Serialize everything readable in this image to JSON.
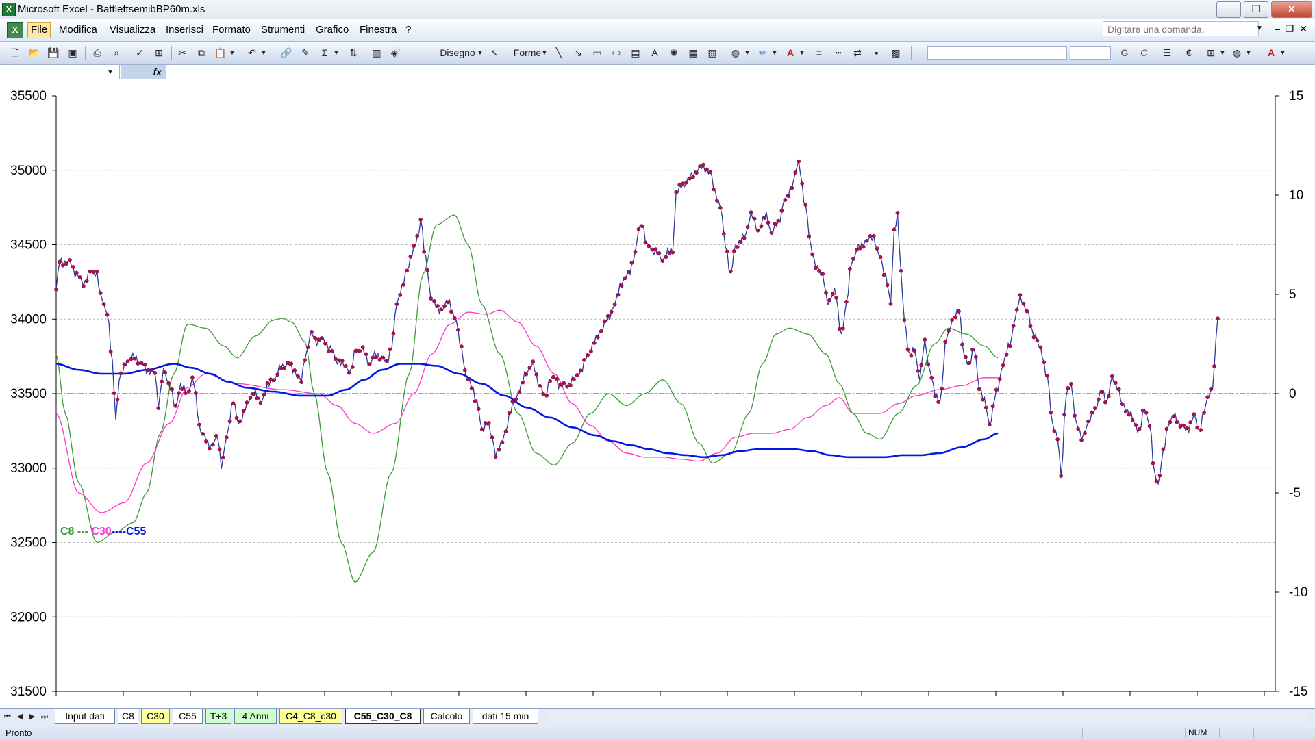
{
  "window": {
    "title": "Microsoft Excel - BattleftsemibBP60m.xls",
    "minimize": "—",
    "maximize": "❐",
    "close": "✕"
  },
  "menu": {
    "items": [
      "File",
      "Modifica",
      "Visualizza",
      "Inserisci",
      "Formato",
      "Strumenti",
      "Grafico",
      "Finestra",
      "?"
    ],
    "help_placeholder": "Digitare una domanda.",
    "mdi": {
      "minimize": "–",
      "restore": "❐",
      "close": "✕"
    }
  },
  "toolbar": {
    "disegno_label": "Disegno",
    "forme_label": "Forme",
    "bold": "G",
    "italic": "C",
    "euro": "€"
  },
  "formula": {
    "fx": "fx",
    "namebox_value": ""
  },
  "chart": {
    "legend": {
      "c8": "C8",
      "sep1": " --- ",
      "c30": "C30",
      "sep2": "----",
      "c55": "C55"
    },
    "colors": {
      "price": "#2b3a9c",
      "markers": "#b0104e",
      "c8": "#3b9a38",
      "c30": "#ff33cc",
      "c55": "#0019e0",
      "zero": "#b04090"
    }
  },
  "chart_data": {
    "type": "line",
    "title": "",
    "x_count": 440,
    "left_axis": {
      "min": 31500,
      "max": 35500,
      "ticks": [
        "31500",
        "32000",
        "32500",
        "33000",
        "33500",
        "34000",
        "34500",
        "35000",
        "35500"
      ]
    },
    "right_axis": {
      "min": -15,
      "max": 15,
      "ticks": [
        "-15",
        "-10",
        "-5",
        "0",
        "5",
        "10",
        "15"
      ]
    },
    "grid": true,
    "price_anchors": [
      [
        0,
        34200
      ],
      [
        2,
        34390
      ],
      [
        8,
        34380
      ],
      [
        12,
        34300
      ],
      [
        16,
        34240
      ],
      [
        20,
        34320
      ],
      [
        24,
        34310
      ],
      [
        26,
        34150
      ],
      [
        30,
        34050
      ],
      [
        33,
        33700
      ],
      [
        35,
        33330
      ],
      [
        37,
        33600
      ],
      [
        42,
        33720
      ],
      [
        46,
        33750
      ],
      [
        50,
        33700
      ],
      [
        54,
        33650
      ],
      [
        58,
        33640
      ],
      [
        60,
        33430
      ],
      [
        63,
        33650
      ],
      [
        67,
        33550
      ],
      [
        70,
        33400
      ],
      [
        73,
        33560
      ],
      [
        77,
        33500
      ],
      [
        80,
        33600
      ],
      [
        85,
        33250
      ],
      [
        90,
        33150
      ],
      [
        95,
        33200
      ],
      [
        97,
        33020
      ],
      [
        100,
        33200
      ],
      [
        104,
        33460
      ],
      [
        107,
        33290
      ],
      [
        112,
        33420
      ],
      [
        116,
        33520
      ],
      [
        120,
        33440
      ],
      [
        124,
        33550
      ],
      [
        128,
        33600
      ],
      [
        132,
        33680
      ],
      [
        136,
        33700
      ],
      [
        140,
        33650
      ],
      [
        144,
        33580
      ],
      [
        146,
        33750
      ],
      [
        150,
        33900
      ],
      [
        153,
        33850
      ],
      [
        157,
        33860
      ],
      [
        161,
        33800
      ],
      [
        165,
        33720
      ],
      [
        170,
        33680
      ],
      [
        173,
        33650
      ],
      [
        176,
        33800
      ],
      [
        180,
        33790
      ],
      [
        184,
        33700
      ],
      [
        187,
        33760
      ],
      [
        191,
        33750
      ],
      [
        194,
        33700
      ],
      [
        197,
        33820
      ],
      [
        200,
        34100
      ],
      [
        203,
        34220
      ],
      [
        206,
        34320
      ],
      [
        209,
        34450
      ],
      [
        211,
        34500
      ],
      [
        213,
        34580
      ],
      [
        214,
        34680
      ],
      [
        217,
        34400
      ],
      [
        220,
        34150
      ],
      [
        225,
        34050
      ],
      [
        230,
        34120
      ],
      [
        234,
        34020
      ],
      [
        238,
        33800
      ],
      [
        241,
        33600
      ],
      [
        244,
        33550
      ],
      [
        247,
        33450
      ],
      [
        250,
        33250
      ],
      [
        253,
        33310
      ],
      [
        256,
        33200
      ],
      [
        258,
        33100
      ],
      [
        261,
        33150
      ],
      [
        264,
        33250
      ],
      [
        266,
        33350
      ],
      [
        269,
        33450
      ],
      [
        272,
        33520
      ],
      [
        276,
        33650
      ],
      [
        280,
        33690
      ],
      [
        284,
        33550
      ],
      [
        287,
        33480
      ],
      [
        290,
        33600
      ],
      [
        293,
        33600
      ],
      [
        296,
        33550
      ],
      [
        300,
        33560
      ],
      [
        304,
        33600
      ],
      [
        308,
        33650
      ],
      [
        312,
        33750
      ],
      [
        316,
        33850
      ],
      [
        320,
        33930
      ],
      [
        324,
        34000
      ],
      [
        328,
        34100
      ],
      [
        332,
        34250
      ],
      [
        336,
        34300
      ],
      [
        340,
        34440
      ],
      [
        342,
        34600
      ],
      [
        344,
        34650
      ],
      [
        347,
        34490
      ],
      [
        351,
        34460
      ],
      [
        356,
        34400
      ],
      [
        359,
        34450
      ],
      [
        362,
        34460
      ],
      [
        364,
        34850
      ],
      [
        368,
        34900
      ],
      [
        372,
        34950
      ],
      [
        376,
        35000
      ],
      [
        380,
        35020
      ],
      [
        384,
        34980
      ],
      [
        387,
        34850
      ],
      [
        390,
        34750
      ],
      [
        393,
        34500
      ],
      [
        396,
        34300
      ],
      [
        399,
        34500
      ],
      [
        404,
        34550
      ],
      [
        408,
        34700
      ],
      [
        412,
        34600
      ],
      [
        417,
        34700
      ],
      [
        420,
        34580
      ],
      [
        424,
        34650
      ],
      [
        428,
        34800
      ],
      [
        432,
        34900
      ],
      [
        436,
        35050
      ],
      [
        440,
        34750
      ],
      [
        443,
        34500
      ],
      [
        446,
        34350
      ],
      [
        450,
        34300
      ],
      [
        453,
        34100
      ],
      [
        457,
        34200
      ],
      [
        461,
        33900
      ],
      [
        464,
        34100
      ],
      [
        467,
        34390
      ],
      [
        471,
        34480
      ],
      [
        476,
        34530
      ],
      [
        480,
        34550
      ],
      [
        483,
        34430
      ],
      [
        487,
        34300
      ],
      [
        490,
        34100
      ],
      [
        492,
        34600
      ],
      [
        494,
        34700
      ],
      [
        496,
        34300
      ],
      [
        498,
        34000
      ],
      [
        501,
        33750
      ],
      [
        504,
        33800
      ],
      [
        507,
        33600
      ],
      [
        510,
        33850
      ],
      [
        513,
        33650
      ],
      [
        516,
        33500
      ],
      [
        519,
        33450
      ],
      [
        523,
        33900
      ],
      [
        527,
        34000
      ],
      [
        530,
        34080
      ],
      [
        533,
        33750
      ],
      [
        536,
        33700
      ],
      [
        539,
        33800
      ],
      [
        542,
        33550
      ],
      [
        545,
        33450
      ],
      [
        548,
        33300
      ],
      [
        552,
        33500
      ],
      [
        556,
        33700
      ],
      [
        560,
        33840
      ],
      [
        563,
        34000
      ],
      [
        566,
        34150
      ],
      [
        570,
        34050
      ],
      [
        574,
        33900
      ],
      [
        578,
        33800
      ],
      [
        582,
        33600
      ],
      [
        585,
        33300
      ],
      [
        588,
        33200
      ],
      [
        590,
        32950
      ],
      [
        593,
        33500
      ],
      [
        596,
        33550
      ],
      [
        599,
        33300
      ],
      [
        602,
        33200
      ],
      [
        606,
        33300
      ],
      [
        610,
        33400
      ],
      [
        614,
        33520
      ],
      [
        617,
        33450
      ],
      [
        620,
        33600
      ],
      [
        623,
        33550
      ],
      [
        626,
        33420
      ],
      [
        630,
        33380
      ],
      [
        633,
        33300
      ],
      [
        636,
        33250
      ],
      [
        639,
        33400
      ],
      [
        642,
        33300
      ],
      [
        645,
        32950
      ],
      [
        647,
        32900
      ],
      [
        650,
        33100
      ],
      [
        653,
        33300
      ],
      [
        656,
        33350
      ],
      [
        660,
        33300
      ],
      [
        664,
        33250
      ],
      [
        668,
        33350
      ],
      [
        671,
        33250
      ],
      [
        674,
        33380
      ],
      [
        677,
        33500
      ],
      [
        679,
        33550
      ],
      [
        682,
        33990
      ]
    ],
    "c8_anchors": [
      [
        0,
        2
      ],
      [
        4,
        -1
      ],
      [
        10,
        -4.5
      ],
      [
        18,
        -7.5
      ],
      [
        26,
        -7
      ],
      [
        34,
        -6.5
      ],
      [
        40,
        -5
      ],
      [
        46,
        -2
      ],
      [
        52,
        1
      ],
      [
        58,
        3.5
      ],
      [
        66,
        3.3
      ],
      [
        74,
        2.4
      ],
      [
        80,
        1.8
      ],
      [
        88,
        2.9
      ],
      [
        96,
        3.7
      ],
      [
        100,
        3.8
      ],
      [
        104,
        3.6
      ],
      [
        110,
        2.6
      ],
      [
        114,
        0
      ],
      [
        120,
        -4
      ],
      [
        126,
        -7.5
      ],
      [
        132,
        -9.5
      ],
      [
        140,
        -8
      ],
      [
        148,
        -4
      ],
      [
        156,
        1
      ],
      [
        162,
        6
      ],
      [
        168,
        8.5
      ],
      [
        176,
        9
      ],
      [
        182,
        7.5
      ],
      [
        188,
        4.5
      ],
      [
        196,
        2
      ],
      [
        204,
        -1
      ],
      [
        212,
        -3
      ],
      [
        220,
        -3.6
      ],
      [
        228,
        -2.5
      ],
      [
        236,
        -1
      ],
      [
        244,
        0
      ],
      [
        252,
        -0.6
      ],
      [
        260,
        0
      ],
      [
        268,
        0.7
      ],
      [
        276,
        -0.5
      ],
      [
        284,
        -2.5
      ],
      [
        290,
        -3.5
      ],
      [
        298,
        -3
      ],
      [
        306,
        -1
      ],
      [
        312,
        1.5
      ],
      [
        318,
        3
      ],
      [
        324,
        3.3
      ],
      [
        332,
        3
      ],
      [
        340,
        2
      ],
      [
        346,
        0.5
      ],
      [
        352,
        -1
      ],
      [
        358,
        -2
      ],
      [
        364,
        -2.3
      ],
      [
        372,
        -1
      ],
      [
        380,
        0.4
      ],
      [
        388,
        2.5
      ],
      [
        394,
        3.3
      ],
      [
        402,
        3
      ],
      [
        410,
        2.4
      ],
      [
        416,
        1.8
      ]
    ],
    "c30_anchors": [
      [
        0,
        -1
      ],
      [
        10,
        -5
      ],
      [
        20,
        -6
      ],
      [
        30,
        -5.5
      ],
      [
        40,
        -3.5
      ],
      [
        50,
        -1.5
      ],
      [
        58,
        0.3
      ],
      [
        66,
        1
      ],
      [
        80,
        0.5
      ],
      [
        100,
        0.2
      ],
      [
        116,
        0
      ],
      [
        124,
        -0.6
      ],
      [
        132,
        -1.5
      ],
      [
        140,
        -2
      ],
      [
        150,
        -1.5
      ],
      [
        158,
        0
      ],
      [
        166,
        2
      ],
      [
        174,
        3.5
      ],
      [
        182,
        4.1
      ],
      [
        190,
        4
      ],
      [
        196,
        4.2
      ],
      [
        204,
        3.6
      ],
      [
        212,
        2.4
      ],
      [
        220,
        1
      ],
      [
        228,
        -0.5
      ],
      [
        236,
        -1.6
      ],
      [
        244,
        -2.4
      ],
      [
        252,
        -3
      ],
      [
        260,
        -3.2
      ],
      [
        268,
        -3.2
      ],
      [
        276,
        -3.3
      ],
      [
        284,
        -3.4
      ],
      [
        292,
        -3
      ],
      [
        300,
        -2.2
      ],
      [
        308,
        -2
      ],
      [
        316,
        -2
      ],
      [
        324,
        -1.8
      ],
      [
        332,
        -1.2
      ],
      [
        340,
        -0.6
      ],
      [
        346,
        -0.2
      ],
      [
        352,
        -1
      ],
      [
        358,
        -1
      ],
      [
        364,
        -1
      ],
      [
        372,
        -0.5
      ],
      [
        380,
        -0.1
      ],
      [
        390,
        0.2
      ],
      [
        400,
        0.4
      ],
      [
        410,
        0.8
      ],
      [
        416,
        0.8
      ]
    ],
    "c55_anchors": [
      [
        0,
        1.5
      ],
      [
        10,
        1.2
      ],
      [
        20,
        1
      ],
      [
        30,
        1
      ],
      [
        40,
        1.2
      ],
      [
        52,
        1.5
      ],
      [
        60,
        1.3
      ],
      [
        68,
        1
      ],
      [
        76,
        0.6
      ],
      [
        84,
        0.3
      ],
      [
        96,
        0.1
      ],
      [
        108,
        -0.1
      ],
      [
        120,
        -0.1
      ],
      [
        128,
        0.2
      ],
      [
        136,
        0.7
      ],
      [
        144,
        1.2
      ],
      [
        152,
        1.5
      ],
      [
        160,
        1.5
      ],
      [
        168,
        1.4
      ],
      [
        178,
        1
      ],
      [
        188,
        0.5
      ],
      [
        198,
        -0.1
      ],
      [
        208,
        -0.7
      ],
      [
        218,
        -1.2
      ],
      [
        228,
        -1.7
      ],
      [
        238,
        -2.1
      ],
      [
        246,
        -2.4
      ],
      [
        254,
        -2.6
      ],
      [
        262,
        -2.8
      ],
      [
        270,
        -3
      ],
      [
        278,
        -3.1
      ],
      [
        286,
        -3.2
      ],
      [
        294,
        -3.1
      ],
      [
        302,
        -2.9
      ],
      [
        310,
        -2.8
      ],
      [
        318,
        -2.8
      ],
      [
        326,
        -2.8
      ],
      [
        334,
        -2.9
      ],
      [
        342,
        -3.1
      ],
      [
        350,
        -3.2
      ],
      [
        358,
        -3.2
      ],
      [
        366,
        -3.2
      ],
      [
        374,
        -3.1
      ],
      [
        382,
        -3.1
      ],
      [
        390,
        -3
      ],
      [
        400,
        -2.7
      ],
      [
        410,
        -2.3
      ],
      [
        416,
        -2
      ]
    ]
  },
  "sheets": {
    "tabs": [
      {
        "label": "Input dati",
        "style": "white"
      },
      {
        "label": "C8",
        "style": "white"
      },
      {
        "label": "C30",
        "style": "yellow"
      },
      {
        "label": "C55",
        "style": "white"
      },
      {
        "label": "T+3",
        "style": "green"
      },
      {
        "label": "4 Anni",
        "style": "green"
      },
      {
        "label": "C4_C8_c30",
        "style": "yellow"
      },
      {
        "label": "C55_C30_C8",
        "style": "active"
      },
      {
        "label": "Calcolo",
        "style": "white"
      },
      {
        "label": "dati 15 min",
        "style": "white"
      }
    ],
    "nav": [
      "⏮",
      "◀",
      "▶",
      "⏭"
    ]
  },
  "status": {
    "text": "Pronto",
    "num": "NUM"
  }
}
